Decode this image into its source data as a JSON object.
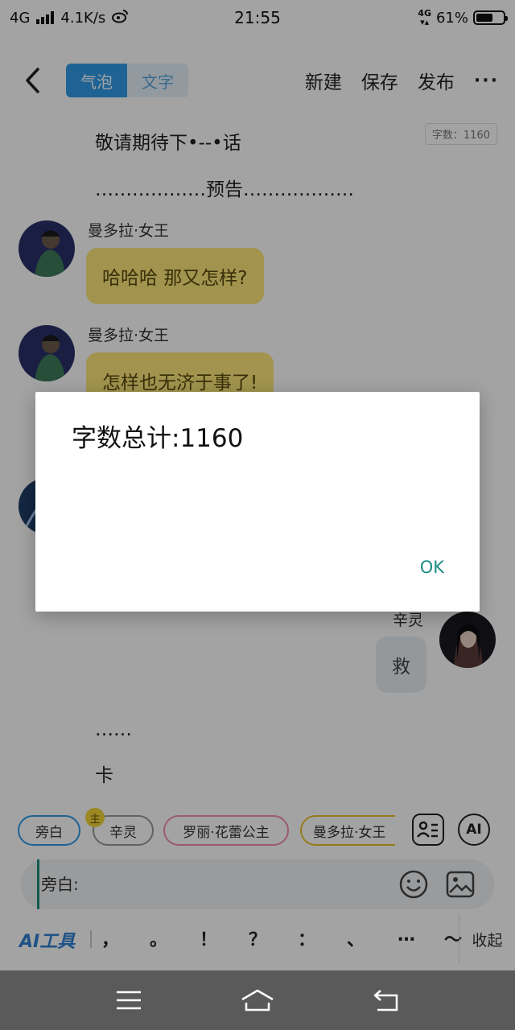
{
  "status_bar": {
    "network": "4G",
    "speed": "4.1K/s",
    "time": "21:55",
    "network_right": "4G",
    "battery_percent": "61%",
    "battery_level": 0.61
  },
  "toolbar": {
    "tab_bubble": "气泡",
    "tab_text": "文字",
    "new_label": "新建",
    "save_label": "保存",
    "publish_label": "发布",
    "more_label": "···"
  },
  "chat": {
    "word_count_badge": "字数：1160",
    "narration_1": "敬请期待下•--•话",
    "narration_2": "………………预告………………",
    "messages": [
      {
        "sender": "曼多拉·女王",
        "text": "哈哈哈  那又怎样?"
      },
      {
        "sender": "曼多拉·女王",
        "text": "怎样也无济于事了!"
      }
    ],
    "right_sender": "辛灵",
    "right_text": "救",
    "narration_3": "……",
    "narration_4": "卡"
  },
  "roles": {
    "items": [
      "旁白",
      "辛灵",
      "罗丽·花蕾公主",
      "曼多拉·女王"
    ],
    "host_badge": "主",
    "ai_label": "AI"
  },
  "input": {
    "value": "",
    "placeholder": "旁白:"
  },
  "punct_bar": {
    "ai_tools": "AI工具",
    "marks": [
      "，",
      "。",
      "！",
      "？",
      "：",
      "、",
      "…",
      "～"
    ],
    "collapse": "收起"
  },
  "dialog": {
    "title": "字数总计:1160",
    "ok": "OK"
  },
  "colors": {
    "accent_blue": "#2f9be8",
    "bubble_yellow": "#fde87b",
    "ok_teal": "#1b8e83"
  }
}
